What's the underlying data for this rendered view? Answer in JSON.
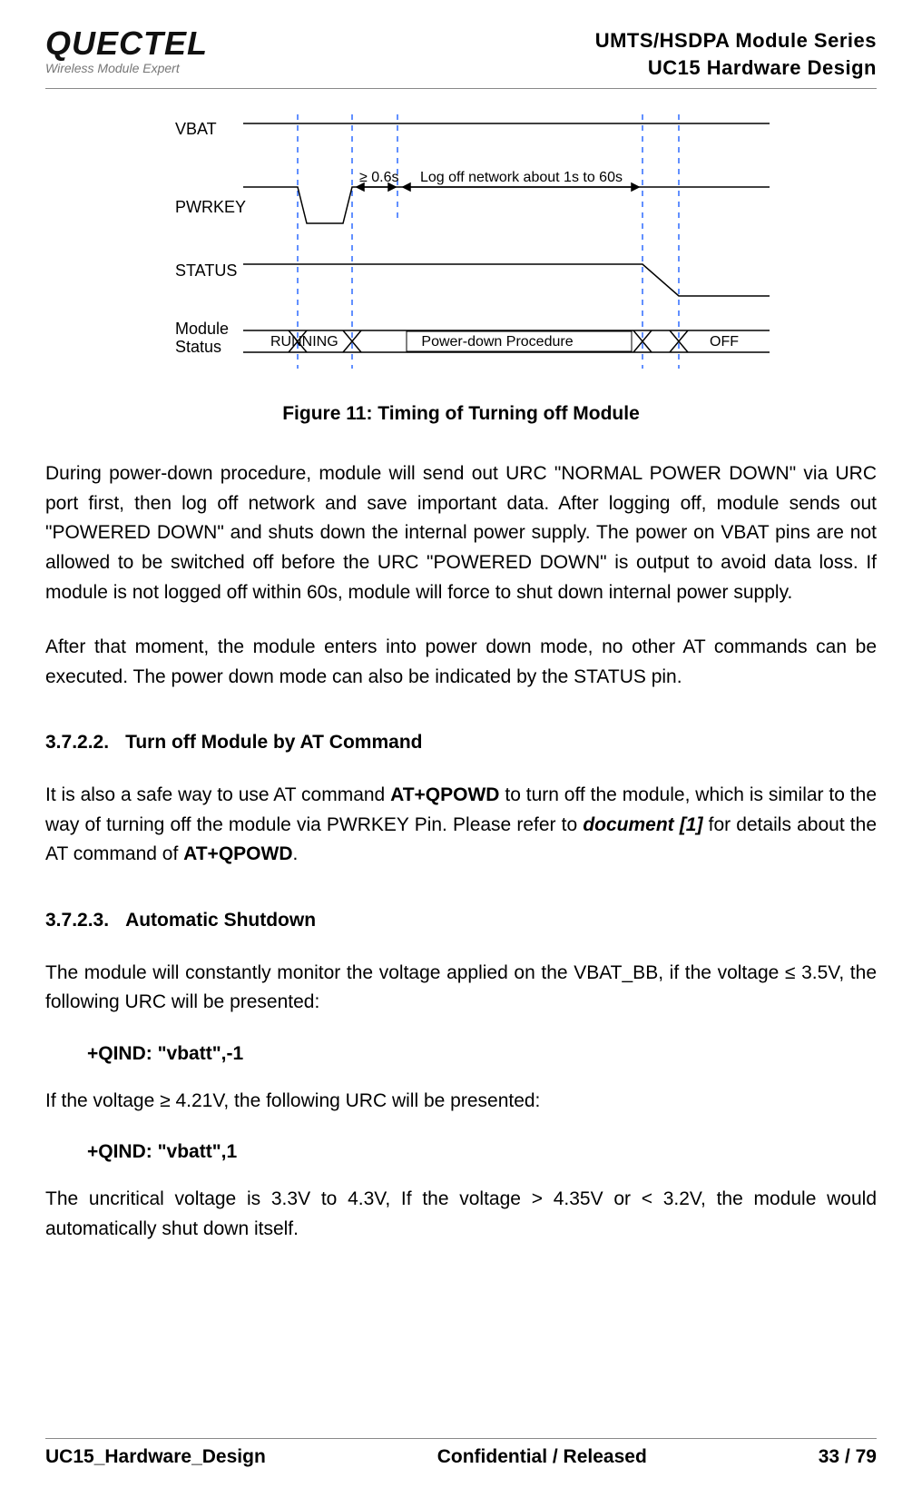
{
  "header": {
    "logo": "QUECTEL",
    "logo_sub": "Wireless Module Expert",
    "line1": "UMTS/HSDPA  Module  Series",
    "line2": "UC15  Hardware  Design"
  },
  "diagram": {
    "labels": {
      "vbat": "VBAT",
      "pwrkey": "PWRKEY",
      "status": "STATUS",
      "modstat1": "Module",
      "modstat2": "Status",
      "pulse": "≥ 0.6s",
      "logoff": "Log off network about 1s to 60s",
      "running": "RUNNING",
      "pdp": "Power-down Procedure",
      "off": "OFF"
    }
  },
  "figcaption": "Figure 11: Timing of Turning off Module",
  "para1": "During power-down procedure, module will send out URC \"NORMAL POWER DOWN\" via URC port first, then log off network and save important data. After logging off, module sends out \"POWERED DOWN\" and shuts down the internal power supply. The power on VBAT pins are not allowed to be switched off before the URC \"POWERED DOWN\" is output to avoid data loss. If module is not logged off within 60s, module will force to shut down internal power supply.",
  "para2": "After that moment, the module enters into power down mode, no other AT commands can be executed. The power down mode can also be indicated by the STATUS pin.",
  "sec3722": {
    "num": "3.7.2.2.",
    "title": "Turn off Module by AT Command"
  },
  "para3_pre": "It is also a safe way to use AT command ",
  "para3_cmd": "AT+QPOWD",
  "para3_mid1": " to turn off the module, which is similar to the way of turning off the module via PWRKEY Pin. Please refer to ",
  "para3_doc": "document [1]",
  "para3_mid2": " for details about the AT command of ",
  "para3_cmd2": "AT+QPOWD",
  "para3_end": ".",
  "sec3723": {
    "num": "3.7.2.3.",
    "title": "Automatic Shutdown"
  },
  "para4": "The  module  will  constantly  monitor  the  voltage  applied  on  the  VBAT_BB,  if  the  voltage  ≤  3.5V,  the following URC will be presented:",
  "urc1": "+QIND: \"vbatt\",-1",
  "para5": "If the voltage ≥ 4.21V, the following URC will be presented:",
  "urc2": "+QIND: \"vbatt\",1",
  "para6": "The uncritical voltage is 3.3V to 4.3V, If the voltage > 4.35V or < 3.2V, the module would automatically shut down itself.",
  "footer": {
    "left": "UC15_Hardware_Design",
    "center": "Confidential / Released",
    "right": "33 / 79"
  },
  "chart_data": {
    "type": "timing_diagram",
    "signals": [
      {
        "name": "VBAT",
        "trace": "constant high"
      },
      {
        "name": "PWRKEY",
        "trace": "high → low pulse (≥ 0.6s) → high",
        "pulse_min_s": 0.6
      },
      {
        "name": "STATUS",
        "trace": "high during power-down procedure → low at OFF"
      },
      {
        "name": "Module Status",
        "states": [
          "RUNNING",
          "Power-down Procedure",
          "OFF"
        ]
      }
    ],
    "annotations": [
      {
        "label": "≥ 0.6s",
        "between": [
          "PWRKEY falling edge",
          "PWRKEY rising edge"
        ]
      },
      {
        "label": "Log off network about 1s to 60s",
        "between": [
          "PWRKEY rising edge",
          "STATUS falling edge"
        ],
        "min_s": 1,
        "max_s": 60
      }
    ]
  }
}
